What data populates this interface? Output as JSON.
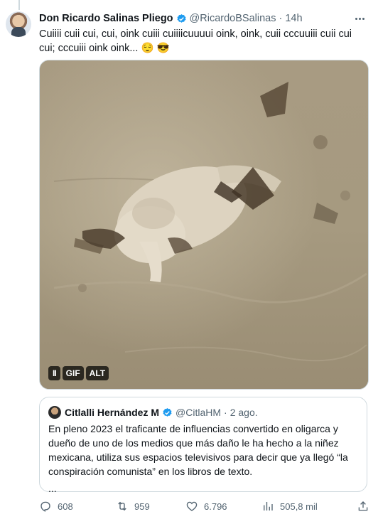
{
  "tweet": {
    "author_name": "Don Ricardo Salinas Pliego",
    "handle": "@RicardoBSalinas",
    "separator": "·",
    "time": "14h",
    "text": "Cuiiii cuii cui, cui, oink cuiii cuiiiicuuuui oink, oink, cuii cccuuiii cuii cui cui; cccuiii oink oink... 😌 😎",
    "media": {
      "tags": [
        "II",
        "GIF",
        "ALT"
      ]
    }
  },
  "quote": {
    "author_name": "Citlalli Hernández M",
    "handle": "@CitlaHM",
    "separator": "·",
    "time": "2 ago.",
    "text": "En pleno 2023 el traficante de influencias convertido en oligarca y dueño de uno de los medios que más daño le ha hecho a la niñez mexicana, utiliza sus espacios televisivos para decir que ya llegó “la conspiración comunista” en los libros de texto.",
    "ellipsis": "..."
  },
  "actions": {
    "replies": "608",
    "retweets": "959",
    "likes": "6.796",
    "views": "505,8 mil"
  },
  "colors": {
    "verified": "#1d9bf0",
    "muted": "#536471",
    "border": "#cfd9de"
  },
  "icons": [
    "more-icon",
    "verified-icon",
    "reply-icon",
    "retweet-icon",
    "like-icon",
    "views-icon",
    "share-icon"
  ]
}
